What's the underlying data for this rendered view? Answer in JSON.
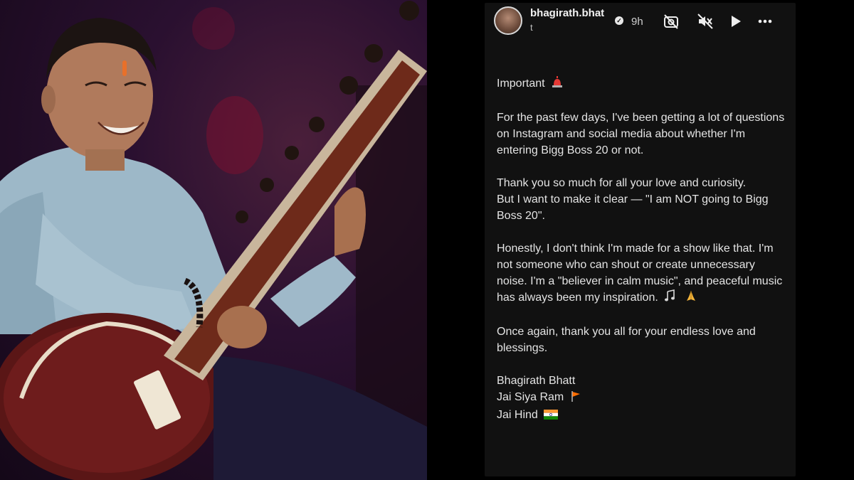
{
  "story": {
    "username": "bhagirath.bhat",
    "verified_mark": "✓",
    "time": "9h",
    "subline": "t",
    "header_icons": [
      "no-camera-icon",
      "mute-icon",
      "play-icon",
      "more-icon"
    ],
    "important": "Important",
    "para1": "For the past few days, I've been getting a lot of questions on Instagram and social media about whether I'm entering Bigg Boss 20 or not.",
    "para2_line1": "Thank you so much for all your love and curiosity.",
    "para2_line2": "But I want to make it clear — \"I am NOT going to Bigg Boss 20\".",
    "para3": "Honestly, I don't think I'm made for a show like that. I'm not someone who can shout or create unnecessary noise. I'm a \"believer in calm music\", and peaceful music has always been my inspiration.",
    "para4": "Once again, thank you all for your endless love and blessings.",
    "sig_name": "Bhagirath Bhatt",
    "sig_line2": "Jai Siya Ram",
    "sig_line3": "Jai Hind"
  },
  "colors": {
    "panel_bg": "#111111",
    "text": "#e4e4e4",
    "siren": "#e53935",
    "flag_orange": "#ff6d00",
    "india_green": "#138808"
  }
}
